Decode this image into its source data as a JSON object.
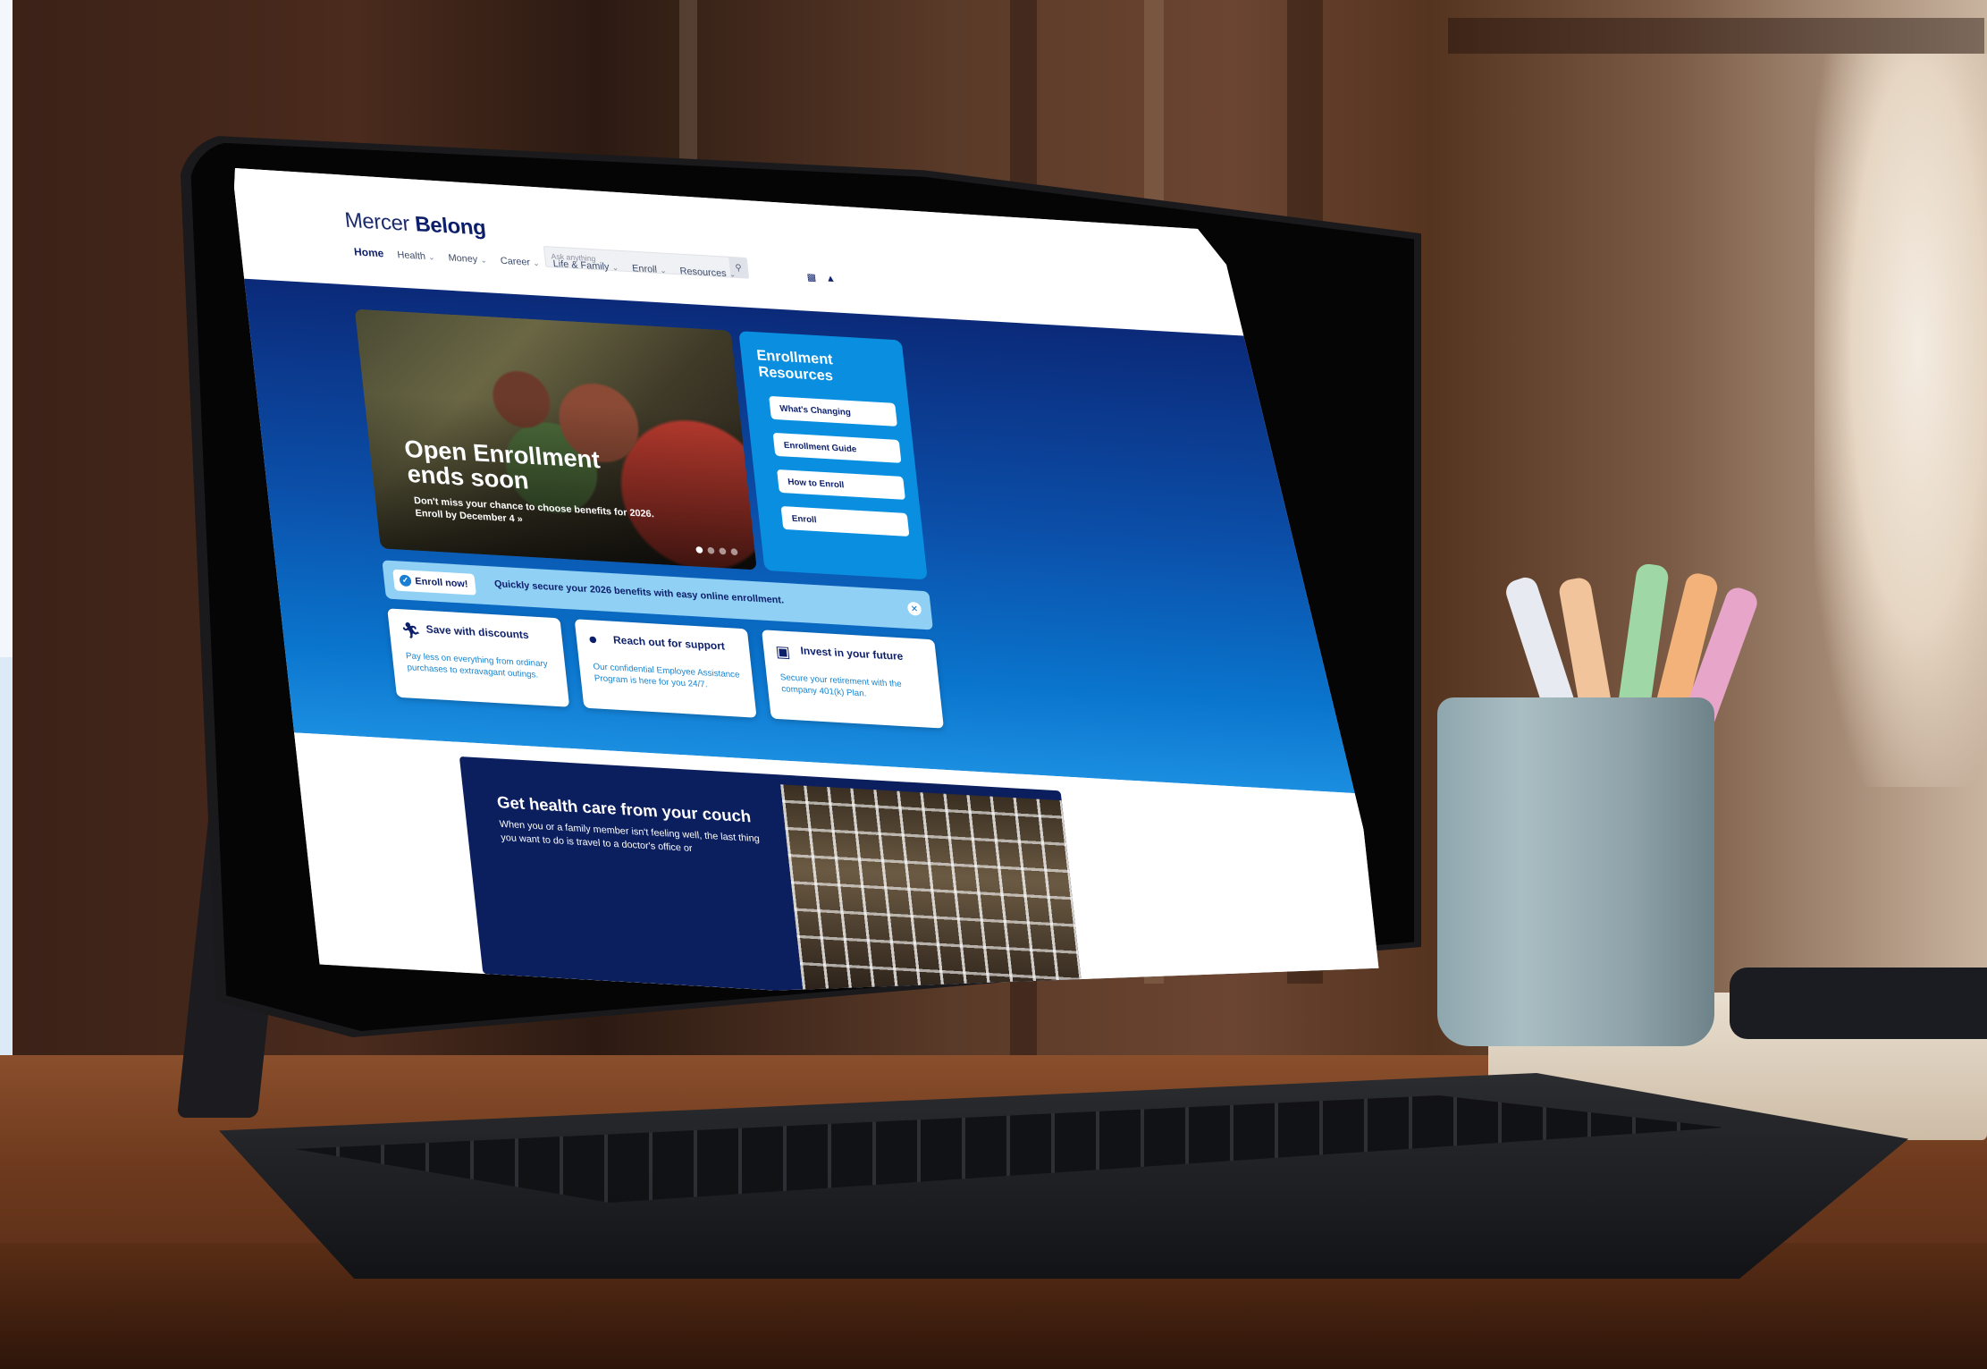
{
  "site": {
    "logo_regular": "Mercer",
    "logo_bold": "Belong"
  },
  "nav": {
    "items": [
      {
        "label": "Home"
      },
      {
        "label": "Health"
      },
      {
        "label": "Money"
      },
      {
        "label": "Career"
      },
      {
        "label": "Life & Family"
      },
      {
        "label": "Enroll"
      },
      {
        "label": "Resources"
      }
    ]
  },
  "search": {
    "placeholder": "Ask anything"
  },
  "hero": {
    "title": "Open Enrollment ends soon",
    "subtitle": "Don't miss your chance to choose benefits for 2026. Enroll by December 4 »",
    "slides_total": 4,
    "slide_active": 1
  },
  "resources": {
    "title": "Enrollment Resources",
    "buttons": [
      {
        "label": "What's Changing"
      },
      {
        "label": "Enrollment Guide"
      },
      {
        "label": "How to Enroll"
      },
      {
        "label": "Enroll"
      }
    ]
  },
  "enroll_bar": {
    "chip_label": "Enroll now!",
    "message": "Quickly secure your 2026 benefits with easy online enrollment."
  },
  "cards": [
    {
      "icon": "running-person-icon",
      "title": "Save with discounts",
      "text": "Pay less on everything from ordinary purchases to extravagant outings."
    },
    {
      "icon": "piggy-bank-icon",
      "title": "Reach out for support",
      "text": "Our confidential Employee Assistance Program is here for you 24/7."
    },
    {
      "icon": "briefcase-icon",
      "title": "Invest in your future",
      "text": "Secure your retirement with the company  401(k) Plan."
    }
  ],
  "promo": {
    "title": "Get health care from your couch",
    "text": "When you or a family member isn't feeling well, the last thing you want to do is travel to a doctor's office or"
  },
  "colors": {
    "brand_navy": "#0d1f6b",
    "hero_blue": "#0a74cc",
    "resources_blue": "#0a8fe0",
    "enroll_bar": "#8fd0f4"
  }
}
